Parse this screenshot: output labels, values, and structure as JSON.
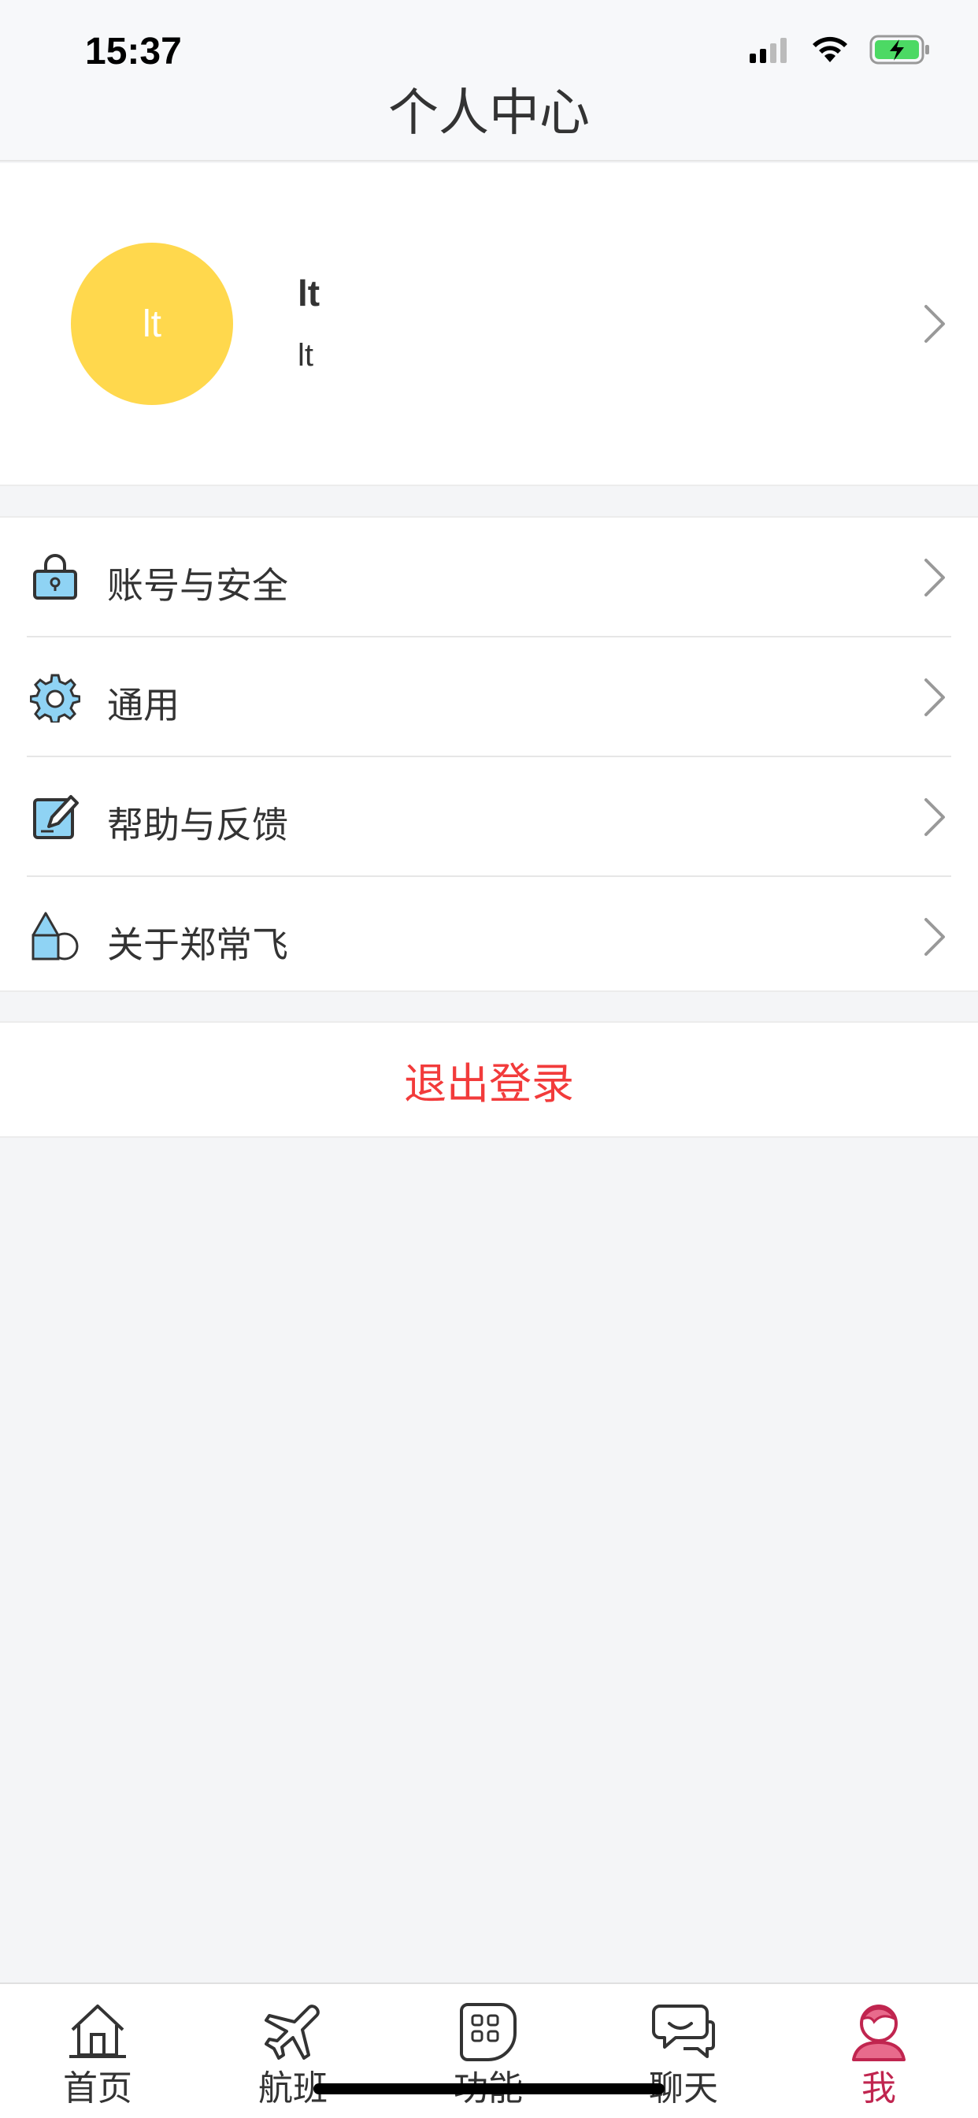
{
  "status_bar": {
    "time": "15:37",
    "icons": [
      "cellular-signal-icon",
      "wifi-icon",
      "battery-charging-icon"
    ],
    "battery_color": "#4cd964"
  },
  "header": {
    "title": "个人中心"
  },
  "profile": {
    "avatar_text": "lt",
    "avatar_color": "#ffd84d",
    "name": "lt",
    "subtitle": "lt"
  },
  "menu": {
    "items": [
      {
        "label": "账号与安全",
        "icon": "lock-icon"
      },
      {
        "label": "通用",
        "icon": "gear-icon"
      },
      {
        "label": "帮助与反馈",
        "icon": "edit-icon"
      },
      {
        "label": "关于郑常飞",
        "icon": "shapes-icon"
      }
    ]
  },
  "logout": {
    "label": "退出登录",
    "color": "#f23b3b"
  },
  "tabbar": {
    "active_color": "#c0254f",
    "items": [
      {
        "label": "首页",
        "icon": "home-icon"
      },
      {
        "label": "航班",
        "icon": "airplane-icon"
      },
      {
        "label": "功能",
        "icon": "apps-icon"
      },
      {
        "label": "聊天",
        "icon": "chat-icon"
      },
      {
        "label": "我",
        "icon": "profile-icon",
        "active": true
      }
    ]
  }
}
